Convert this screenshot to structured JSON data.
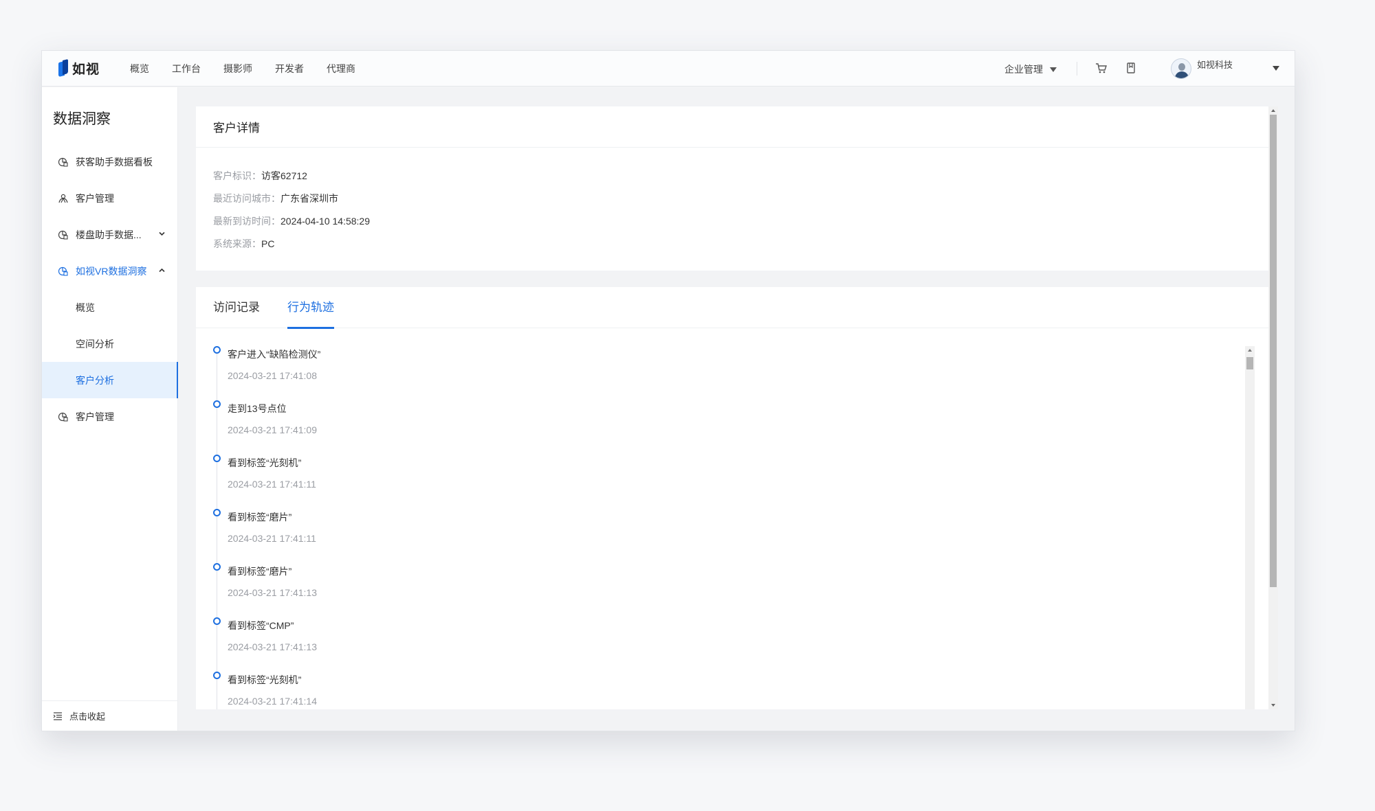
{
  "app": {
    "logo_text": "如视"
  },
  "top_nav": [
    "概览",
    "工作台",
    "摄影师",
    "开发者",
    "代理商"
  ],
  "header": {
    "enterprise_label": "企业管理",
    "user_name": "如视科技",
    "icons": [
      "cart-icon",
      "document-icon"
    ]
  },
  "sidebar": {
    "title": "数据洞察",
    "items": [
      {
        "label": "获客助手数据看板",
        "icon": "chart-icon"
      },
      {
        "label": "客户管理",
        "icon": "people-icon"
      },
      {
        "label": "楼盘助手数据...",
        "icon": "chart-icon"
      },
      {
        "label": "如视VR数据洞察",
        "icon": "chart-icon"
      },
      {
        "label": "客户管理",
        "icon": "chart-icon"
      }
    ],
    "sub_items": [
      "概览",
      "空间分析",
      "客户分析"
    ],
    "selected_sub": "客户分析",
    "collapse_label": "点击收起"
  },
  "detail": {
    "title": "客户详情",
    "fields": [
      {
        "label": "客户标识：",
        "value": "访客62712"
      },
      {
        "label": "最近访问城市：",
        "value": "广东省深圳市"
      },
      {
        "label": "最新到访时间：",
        "value": "2024-04-10 14:58:29"
      },
      {
        "label": "系统来源：",
        "value": "PC"
      }
    ]
  },
  "tabs": [
    "访问记录",
    "行为轨迹"
  ],
  "active_tab": "行为轨迹",
  "timeline": [
    {
      "title": "客户进入“缺陷检测仪”",
      "time": "2024-03-21 17:41:08"
    },
    {
      "title": "走到13号点位",
      "time": "2024-03-21 17:41:09"
    },
    {
      "title": "看到标签“光刻机”",
      "time": "2024-03-21 17:41:11"
    },
    {
      "title": "看到标签“磨片”",
      "time": "2024-03-21 17:41:11"
    },
    {
      "title": "看到标签“磨片”",
      "time": "2024-03-21 17:41:13"
    },
    {
      "title": "看到标签“CMP”",
      "time": "2024-03-21 17:41:13"
    },
    {
      "title": "看到标签“光刻机”",
      "time": "2024-03-21 17:41:14"
    }
  ],
  "colors": {
    "accent": "#1d6fe0",
    "selected_bg": "#e6f1fd"
  }
}
